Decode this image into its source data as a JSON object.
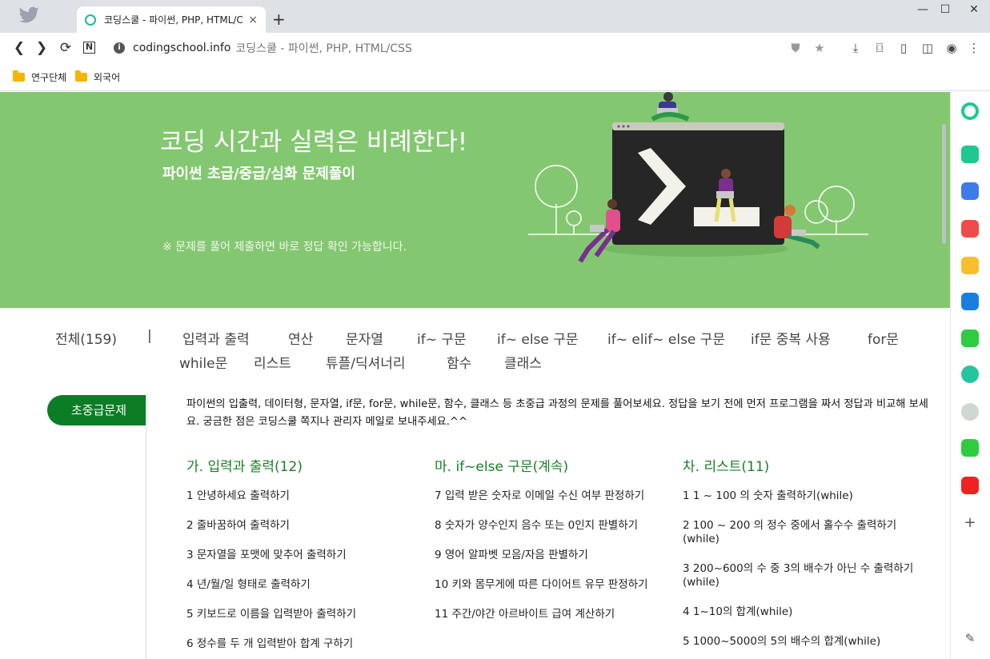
{
  "browser": {
    "tab_title": "코딩스쿨 - 파이썬, PHP, HTML/CSS",
    "tab_close": "×",
    "new_tab": "+",
    "window_controls": [
      "—",
      "☐",
      "✕"
    ],
    "url_domain": "codingschool.info",
    "url_title": "코딩스쿨 - 파이썬, PHP, HTML/CSS",
    "bookmarks": [
      "연구단체",
      "외국어"
    ]
  },
  "hero": {
    "title": "코딩 시간과 실력은 비례한다!",
    "subtitle": "파이썬 초급/중급/심화 문제풀이",
    "note": "※ 문제를 풀어 제출하면 바로 정답 확인 가능합니다."
  },
  "categories": [
    "전체(159)",
    "|",
    "입력과 출력",
    "연산",
    "문자열",
    "if~ 구문",
    "if~ else 구문",
    "if~ elif~ else 구문",
    "if문 중복 사용",
    "for문",
    "while문",
    "리스트",
    "튜플/딕셔너리",
    "함수",
    "클래스"
  ],
  "side_tab": "초중급문제",
  "intro": "파이썬의 입출력, 데이터형, 문자열, if문, for문, while문, 함수, 클래스 등 초중급 과정의 문제를 풀어보세요. 정답을 보기 전에 먼저 프로그램을 짜서 정답과 비교해 보세요. 궁금한 점은 코딩스쿨 쪽지나 관리자 메일로 보내주세요.^^",
  "columns": [
    {
      "heading": "가. 입력과 출력(12)",
      "items": [
        "1 안녕하세요 출력하기",
        "2 줄바꿈하여 출력하기",
        "3 문자열을 포맷에 맞추어 출력하기",
        "4 년/월/일 형태로 출력하기",
        "5 키보드로 이름을 입력받아 출력하기",
        "6 정수를 두 개 입력받아 합계 구하기"
      ]
    },
    {
      "heading": "마. if~else 구문(계속)",
      "items": [
        "7 입력 받은 숫자로 이메일 수신 여부 판정하기",
        "8 숫자가 양수인지 음수 또는 0인지 판별하기",
        "9 영어 알파벳 모음/자음 판별하기",
        "10 키와 몸무게에 따른 다이어트 유무 판정하기",
        "11 주간/야간 아르바이트 급여 계산하기"
      ]
    },
    {
      "heading": "차. 리스트(11)",
      "items": [
        "1 1 ~ 100 의 숫자 출력하기(while)",
        "2 100 ~ 200 의 정수 중에서 홀수수 출력하기(while)",
        "3 200~600의 수 중 3의 배수가 아닌 수 출력하기(while)",
        "4 1~10의 합계(while)",
        "5 1000~5000의 5의 배수의 합계(while)"
      ]
    }
  ],
  "colors": {
    "hero_bg": "#84c771",
    "accent_green": "#0a7d25",
    "heading_green": "#1a7f28"
  }
}
